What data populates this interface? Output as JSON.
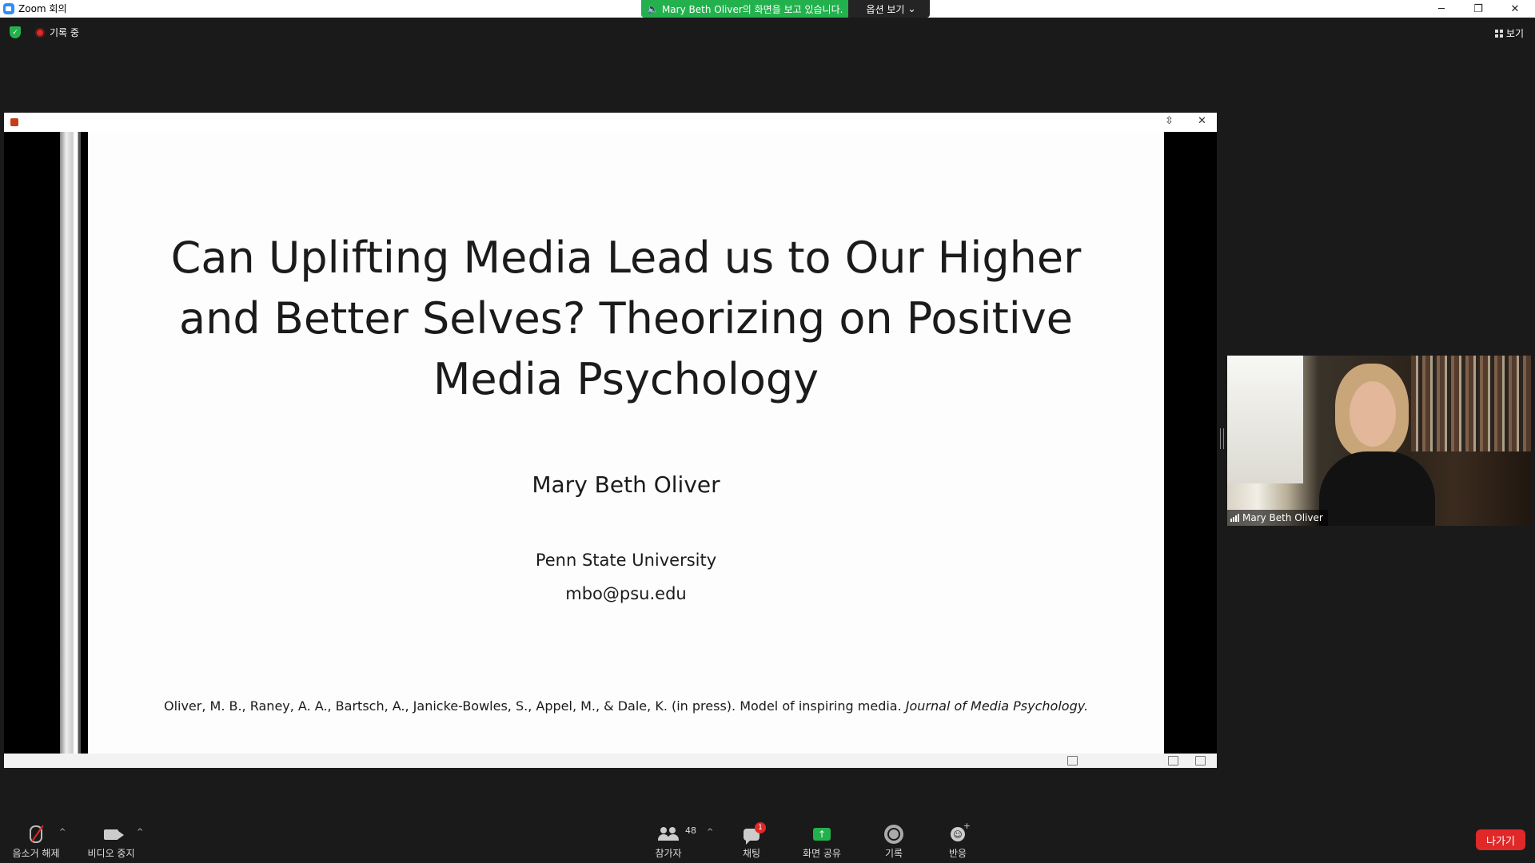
{
  "window": {
    "title": "Zoom 회의",
    "share_message": "Mary Beth Oliver의 화면을 보고 있습니다.",
    "view_options": "옵션 보기",
    "minimize": "─",
    "restore": "❐",
    "close": "✕"
  },
  "meeting": {
    "recording_label": "기록 중",
    "view_label": "보기"
  },
  "shared_screen": {
    "slide": {
      "title": "Can Uplifting Media Lead us to Our Higher and Better Selves? Theorizing on Positive Media Psychology",
      "author": "Mary Beth Oliver",
      "affiliation": "Penn State University",
      "email": "mbo@psu.edu",
      "citation_plain": "Oliver, M. B., Raney, A. A., Bartsch, A., Janicke-Bowles, S., Appel, M., & Dale, K. (in press). Model of inspiring media.",
      "citation_journal": "Journal of Media Psychology."
    }
  },
  "participant_video": {
    "name": "Mary Beth Oliver"
  },
  "toolbar": {
    "mute_label": "음소거 해제",
    "video_label": "비디오 중지",
    "participants_label": "참가자",
    "participants_count": "48",
    "chat_label": "채팅",
    "chat_badge": "1",
    "share_label": "화면 공유",
    "record_label": "기록",
    "reactions_label": "반응",
    "leave_label": "나가기"
  },
  "colors": {
    "background": "#1a1a1a",
    "share_green": "#23b14d",
    "leave_red": "#e02828",
    "zoom_blue": "#2d8cff"
  }
}
